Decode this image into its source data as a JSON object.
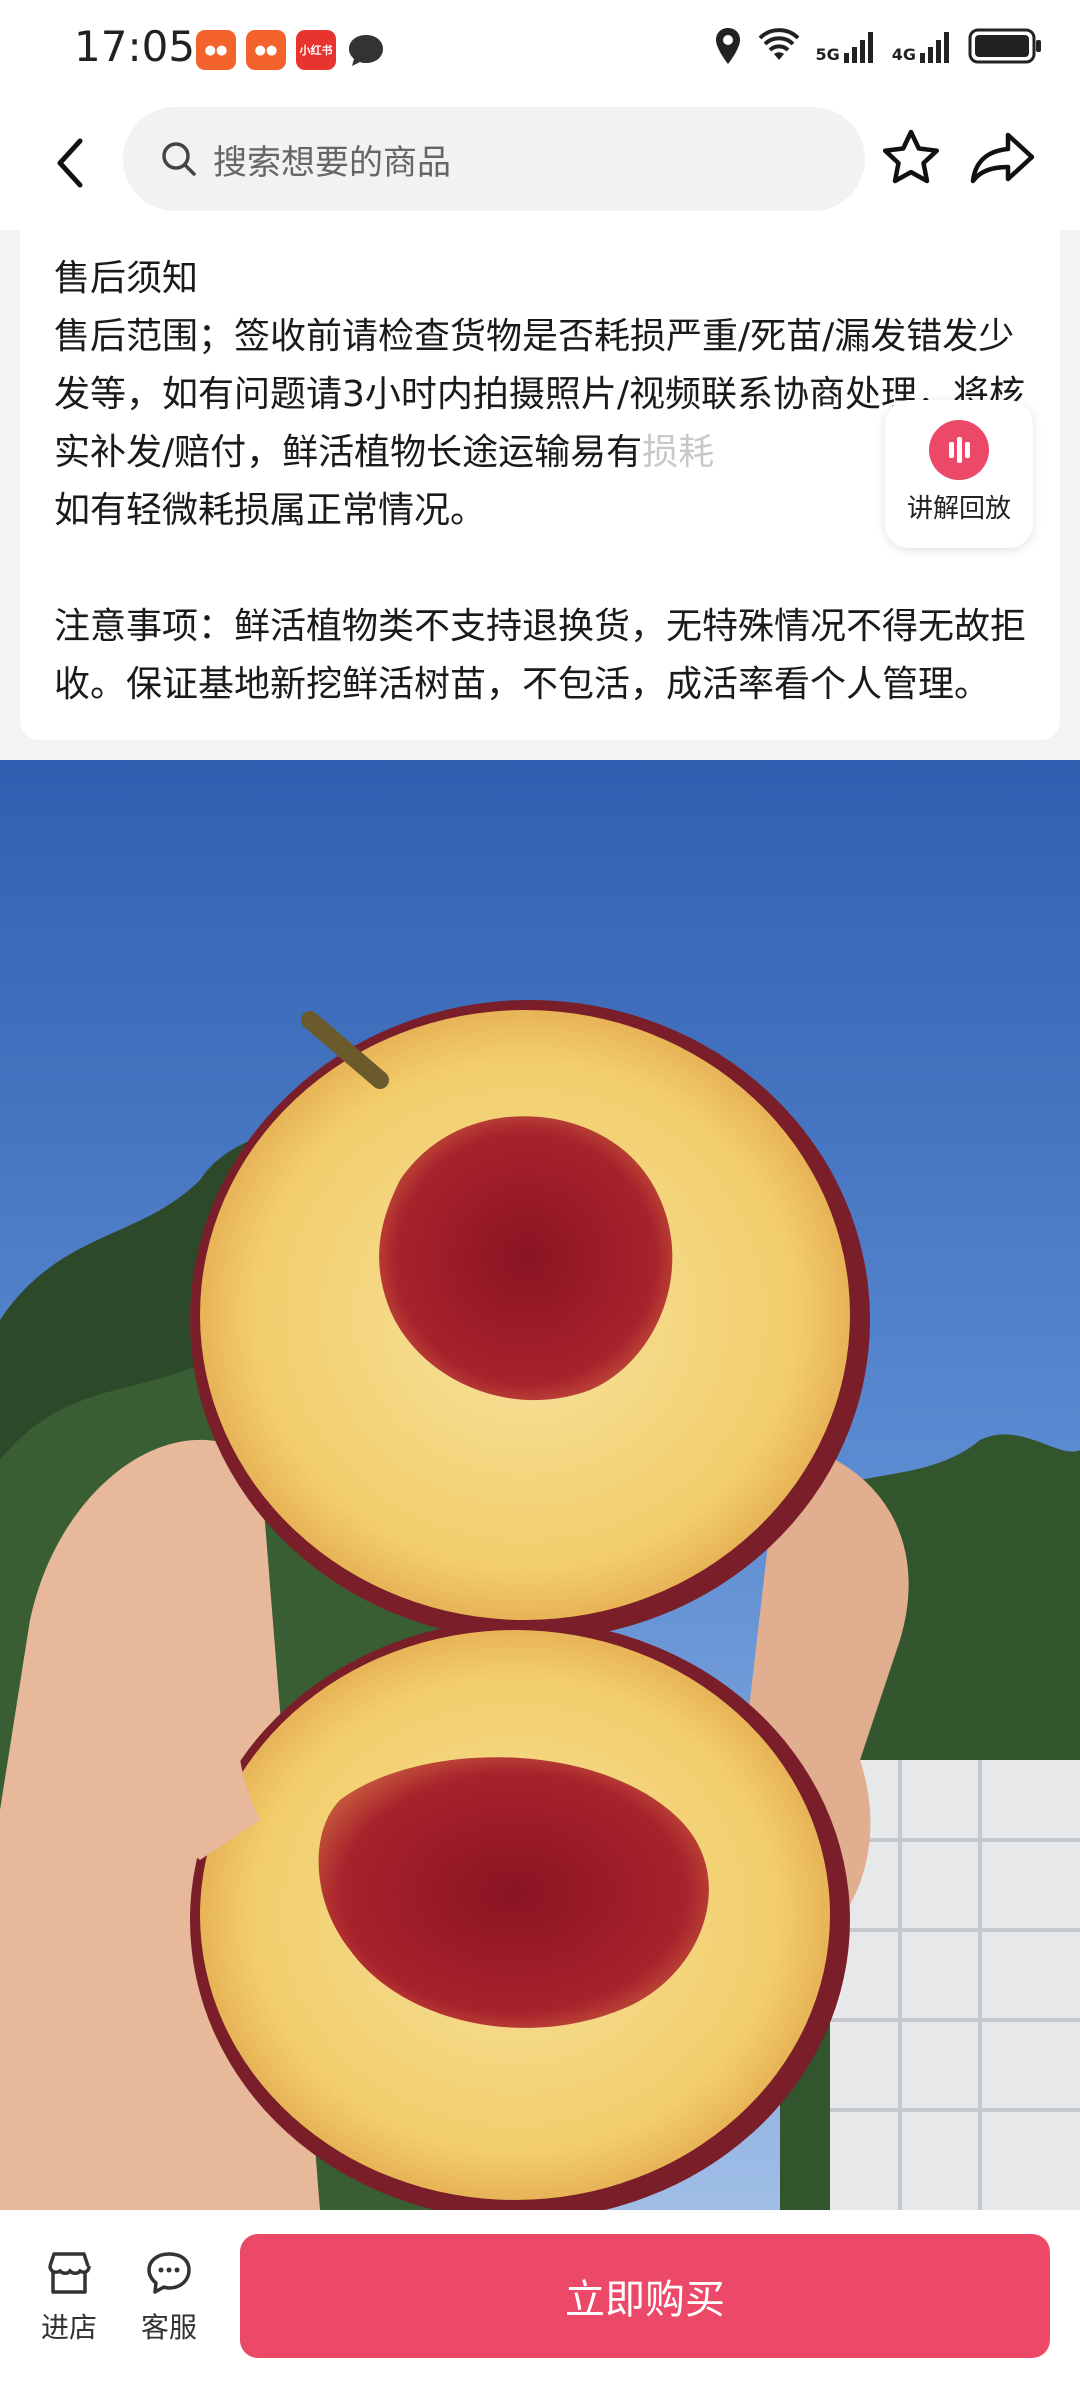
{
  "status_bar": {
    "time": "17:05",
    "network_1": "5G",
    "network_2": "4G",
    "notif_xiaohongshu": "小红书"
  },
  "nav": {
    "search_placeholder": "搜索想要的商品",
    "back_icon": "chevron-left-icon",
    "favorite_icon": "star-outline-icon",
    "share_icon": "share-arrow-icon"
  },
  "notice": {
    "title": "售后须知",
    "range_text": "售后范围；签收前请检查货物是否耗损严重/死苗/漏发错发少发等，如有问题请3小时内拍摄照片/视频联系协商处理，将核实补发/赔付，鲜活植物长途运输易有",
    "range_fade": "损耗",
    "range_tail": "如有轻微耗损属正常情况。",
    "caution_text": "注意事项：鲜活植物类不支持退换货，无特殊情况不得无故拒收。保证基地新挖鲜活树苗，不包活，成活率看个人管理。"
  },
  "replay": {
    "label": "讲解回放",
    "accent": "#ec4867"
  },
  "bottom_bar": {
    "store_label": "进店",
    "service_label": "客服",
    "buy_label": "立即购买",
    "buy_color": "#ec4867"
  }
}
